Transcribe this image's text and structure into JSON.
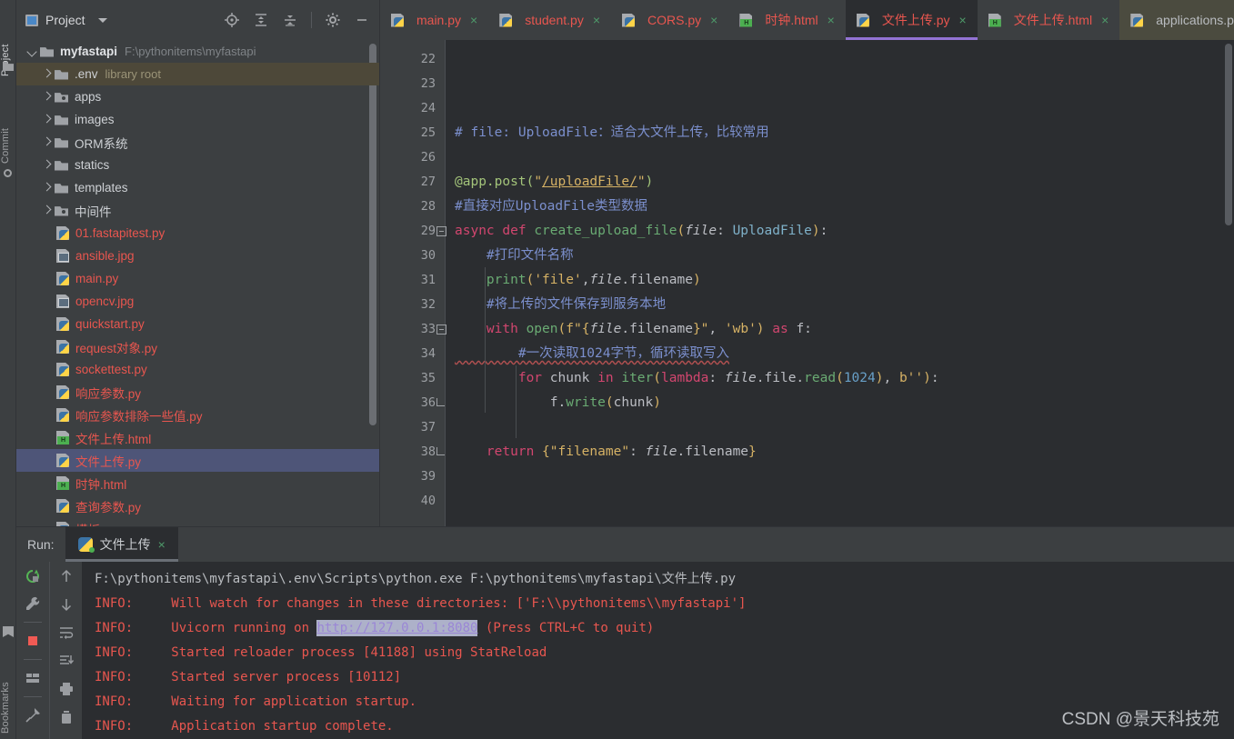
{
  "rail": {
    "project": "Project",
    "commit": "Commit",
    "bookmarks": "Bookmarks"
  },
  "project_panel": {
    "title": "Project",
    "tools": [
      {
        "name": "locate-icon",
        "label": "Select Opened File"
      },
      {
        "name": "expand-all-icon",
        "label": "Expand All"
      },
      {
        "name": "collapse-all-icon",
        "label": "Collapse All"
      },
      {
        "name": "settings-gear-icon",
        "label": "Settings"
      },
      {
        "name": "minimize-icon",
        "label": "Hide"
      }
    ],
    "tree": [
      {
        "label": "myfastapi",
        "sub": "F:\\pythonitems\\myfastapi",
        "type": "folder",
        "state": "open",
        "indent": 0,
        "bold": true
      },
      {
        "label": ".env",
        "sub": "library root",
        "type": "folder",
        "state": "closed",
        "indent": 1,
        "highlight": "env"
      },
      {
        "label": "apps",
        "sub": "",
        "type": "folder-mod",
        "state": "closed",
        "indent": 1
      },
      {
        "label": "images",
        "sub": "",
        "type": "folder",
        "state": "closed",
        "indent": 1
      },
      {
        "label": "ORM系统",
        "sub": "",
        "type": "folder",
        "state": "closed",
        "indent": 1
      },
      {
        "label": "statics",
        "sub": "",
        "type": "folder",
        "state": "closed",
        "indent": 1
      },
      {
        "label": "templates",
        "sub": "",
        "type": "folder",
        "state": "closed",
        "indent": 1
      },
      {
        "label": "中间件",
        "sub": "",
        "type": "folder-mod",
        "state": "closed",
        "indent": 1
      },
      {
        "label": "01.fastapitest.py",
        "sub": "",
        "type": "py",
        "indent": 2
      },
      {
        "label": "ansible.jpg",
        "sub": "",
        "type": "img",
        "indent": 2
      },
      {
        "label": "main.py",
        "sub": "",
        "type": "py",
        "indent": 2
      },
      {
        "label": "opencv.jpg",
        "sub": "",
        "type": "img",
        "indent": 2
      },
      {
        "label": "quickstart.py",
        "sub": "",
        "type": "py",
        "indent": 2
      },
      {
        "label": "request对象.py",
        "sub": "",
        "type": "py",
        "indent": 2
      },
      {
        "label": "sockettest.py",
        "sub": "",
        "type": "py",
        "indent": 2
      },
      {
        "label": "响应参数.py",
        "sub": "",
        "type": "py",
        "indent": 2
      },
      {
        "label": "响应参数排除一些值.py",
        "sub": "",
        "type": "py",
        "indent": 2
      },
      {
        "label": "文件上传.html",
        "sub": "",
        "type": "html",
        "indent": 2
      },
      {
        "label": "文件上传.py",
        "sub": "",
        "type": "py",
        "indent": 2,
        "selected": true
      },
      {
        "label": "时钟.html",
        "sub": "",
        "type": "html",
        "indent": 2
      },
      {
        "label": "查询参数.py",
        "sub": "",
        "type": "py",
        "indent": 2
      },
      {
        "label": "模板.py",
        "sub": "",
        "type": "py",
        "indent": 2
      }
    ]
  },
  "editor": {
    "tabs": [
      {
        "label": "main.py",
        "type": "py",
        "active": false
      },
      {
        "label": "student.py",
        "type": "py",
        "active": false
      },
      {
        "label": "CORS.py",
        "type": "py",
        "active": false
      },
      {
        "label": "时钟.html",
        "type": "html",
        "active": false
      },
      {
        "label": "文件上传.py",
        "type": "py",
        "active": true
      },
      {
        "label": "文件上传.html",
        "type": "html",
        "active": false
      },
      {
        "label": "applications.py",
        "type": "py",
        "active": false,
        "hover": true
      }
    ],
    "close_glyph": "×",
    "first_line_number": 22,
    "lines": [
      {
        "n": 22,
        "segs": []
      },
      {
        "n": 23,
        "segs": []
      },
      {
        "n": 24,
        "segs": []
      },
      {
        "n": 25,
        "segs": [
          {
            "t": "# file: UploadFile：适合大文件上传，比较常用",
            "c": "c-cmt"
          }
        ]
      },
      {
        "n": 26,
        "segs": []
      },
      {
        "n": 27,
        "segs": [
          {
            "t": "@app.post(",
            "c": "c-dec"
          },
          {
            "t": "\"",
            "c": "c-str"
          },
          {
            "t": "/uploadFile/",
            "c": "c-link"
          },
          {
            "t": "\"",
            "c": "c-str"
          },
          {
            "t": ")",
            "c": "c-dec"
          }
        ]
      },
      {
        "n": 28,
        "segs": [
          {
            "t": "#直接对应UploadFile类型数据",
            "c": "c-cmt"
          }
        ]
      },
      {
        "n": 29,
        "segs": [
          {
            "t": "async def ",
            "c": "c-kw"
          },
          {
            "t": "create_upload_file",
            "c": "c-fn"
          },
          {
            "t": "(",
            "c": "c-par"
          },
          {
            "t": "file",
            "c": "c-it"
          },
          {
            "t": ": ",
            "c": "c-punc"
          },
          {
            "t": "UploadFile",
            "c": "c-cls"
          },
          {
            "t": ")",
            "c": "c-par"
          },
          {
            "t": ":",
            "c": "c-punc"
          }
        ],
        "fold": "minus"
      },
      {
        "n": 30,
        "segs": [
          {
            "t": "    #打印文件名称",
            "c": "c-cmt"
          }
        ]
      },
      {
        "n": 31,
        "segs": [
          {
            "t": "    print",
            "c": "c-fn"
          },
          {
            "t": "(",
            "c": "c-par"
          },
          {
            "t": "'file'",
            "c": "c-str"
          },
          {
            "t": ",",
            "c": "c-punc"
          },
          {
            "t": "file",
            "c": "c-it"
          },
          {
            "t": ".filename",
            "c": "c-punc"
          },
          {
            "t": ")",
            "c": "c-par"
          }
        ]
      },
      {
        "n": 32,
        "segs": [
          {
            "t": "    #将上传的文件保存到服务本地",
            "c": "c-cmt"
          }
        ]
      },
      {
        "n": 33,
        "segs": [
          {
            "t": "    with ",
            "c": "c-kw"
          },
          {
            "t": "open",
            "c": "c-fn"
          },
          {
            "t": "(",
            "c": "c-par"
          },
          {
            "t": "f\"{",
            "c": "c-str"
          },
          {
            "t": "file",
            "c": "c-it"
          },
          {
            "t": ".filename",
            "c": "c-punc"
          },
          {
            "t": "}\"",
            "c": "c-str"
          },
          {
            "t": ", ",
            "c": "c-punc"
          },
          {
            "t": "'wb'",
            "c": "c-str"
          },
          {
            "t": ")",
            "c": "c-par"
          },
          {
            "t": " as ",
            "c": "c-kw"
          },
          {
            "t": "f:",
            "c": "c-punc"
          }
        ],
        "fold": "minus"
      },
      {
        "n": 34,
        "segs": [
          {
            "t": "        #一次读取1024字节，循环读取写入",
            "c": "c-cmt"
          }
        ]
      },
      {
        "n": 35,
        "segs": [
          {
            "t": "        for ",
            "c": "c-kw"
          },
          {
            "t": "chunk",
            "c": "c-punc"
          },
          {
            "t": " in ",
            "c": "c-kw"
          },
          {
            "t": "iter",
            "c": "c-fn"
          },
          {
            "t": "(",
            "c": "c-par"
          },
          {
            "t": "lambda",
            "c": "c-kw"
          },
          {
            "t": ": ",
            "c": "c-punc"
          },
          {
            "t": "file",
            "c": "c-it"
          },
          {
            "t": ".file.",
            "c": "c-punc"
          },
          {
            "t": "read",
            "c": "c-fn"
          },
          {
            "t": "(",
            "c": "c-par"
          },
          {
            "t": "1024",
            "c": "c-num"
          },
          {
            "t": ")",
            "c": "c-par"
          },
          {
            "t": ", ",
            "c": "c-punc"
          },
          {
            "t": "b''",
            "c": "c-str"
          },
          {
            "t": ")",
            "c": "c-par"
          },
          {
            "t": ":",
            "c": "c-punc"
          }
        ]
      },
      {
        "n": 36,
        "segs": [
          {
            "t": "            f.",
            "c": "c-punc"
          },
          {
            "t": "write",
            "c": "c-fn"
          },
          {
            "t": "(",
            "c": "c-par"
          },
          {
            "t": "chunk",
            "c": "c-punc"
          },
          {
            "t": ")",
            "c": "c-par"
          }
        ],
        "fold": "end"
      },
      {
        "n": 37,
        "segs": []
      },
      {
        "n": 38,
        "segs": [
          {
            "t": "    return ",
            "c": "c-kw"
          },
          {
            "t": "{",
            "c": "c-par"
          },
          {
            "t": "\"filename\"",
            "c": "c-str"
          },
          {
            "t": ": ",
            "c": "c-punc"
          },
          {
            "t": "file",
            "c": "c-it"
          },
          {
            "t": ".filename",
            "c": "c-punc"
          },
          {
            "t": "}",
            "c": "c-par"
          }
        ],
        "fold": "end"
      },
      {
        "n": 39,
        "segs": []
      },
      {
        "n": 40,
        "segs": []
      }
    ]
  },
  "run_panel": {
    "label": "Run:",
    "tab_label": "文件上传",
    "close_glyph": "×",
    "left_tools": [
      {
        "name": "rerun-icon"
      },
      {
        "name": "wrench-icon"
      },
      {
        "name": "stop-icon"
      },
      {
        "name": "layout-icon"
      },
      {
        "name": "pin-icon"
      }
    ],
    "right_tools": [
      {
        "name": "arrow-up-icon"
      },
      {
        "name": "arrow-down-icon"
      },
      {
        "name": "soft-wrap-icon"
      },
      {
        "name": "scroll-to-end-icon"
      },
      {
        "name": "print-icon"
      },
      {
        "name": "trash-icon"
      }
    ],
    "console": [
      {
        "type": "cmd",
        "text": "F:\\pythonitems\\myfastapi\\.env\\Scripts\\python.exe F:\\pythonitems\\myfastapi\\文件上传.py"
      },
      {
        "type": "info",
        "prefix": "INFO:",
        "text": "     Will watch for changes in these directories: ['F:\\\\pythonitems\\\\myfastapi']"
      },
      {
        "type": "link",
        "prefix": "INFO:",
        "pre": "     Uvicorn running on ",
        "url": "http://127.0.0.1:8080",
        "post": " (Press CTRL+C to quit)"
      },
      {
        "type": "info",
        "prefix": "INFO:",
        "text": "     Started reloader process [41188] using StatReload"
      },
      {
        "type": "info",
        "prefix": "INFO:",
        "text": "     Started server process [10112]"
      },
      {
        "type": "info",
        "prefix": "INFO:",
        "text": "     Waiting for application startup."
      },
      {
        "type": "info",
        "prefix": "INFO:",
        "text": "     Application startup complete."
      }
    ]
  },
  "watermark": "CSDN @景天科技苑",
  "colors": {
    "panel_bg": "#3c3f41",
    "editor_bg": "#2b2d30",
    "selection": "#4e5578",
    "env_highlight": "#4d4839",
    "file_red": "#e8564f",
    "active_tab_underline": "#9373d4",
    "console_red": "#e8564f",
    "link_purple": "#9a86d6"
  }
}
